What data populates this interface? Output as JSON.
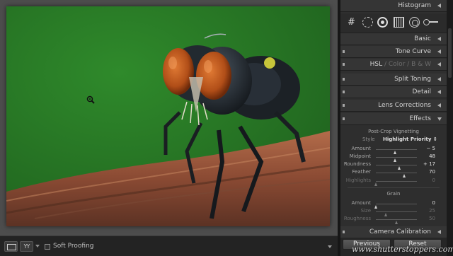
{
  "panels": {
    "histogram": "Histogram",
    "basic": "Basic",
    "tone_curve": "Tone Curve",
    "hsl_tabs": [
      "HSL",
      "Color",
      "B & W"
    ],
    "split_toning": "Split Toning",
    "detail": "Detail",
    "lens_corrections": "Lens Corrections",
    "effects": "Effects",
    "camera_calibration": "Camera Calibration"
  },
  "effects": {
    "vignette_title": "Post-Crop Vignetting",
    "style_label": "Style",
    "style_value": "Highlight Priority",
    "style_arrows": "↕",
    "vignette": [
      {
        "label": "Amount",
        "value": "− 5",
        "fraction": 0.48
      },
      {
        "label": "Midpoint",
        "value": "48",
        "fraction": 0.48
      },
      {
        "label": "Roundness",
        "value": "+ 17",
        "fraction": 0.58
      },
      {
        "label": "Feather",
        "value": "70",
        "fraction": 0.7
      },
      {
        "label": "Highlights",
        "value": "0",
        "fraction": 0.0
      }
    ],
    "grain_title": "Grain",
    "grain": [
      {
        "label": "Amount",
        "value": "0",
        "fraction": 0.0
      },
      {
        "label": "Size",
        "value": "25",
        "fraction": 0.25
      },
      {
        "label": "Roughness",
        "value": "50",
        "fraction": 0.5
      }
    ]
  },
  "toolbar": {
    "compare_glyph": "YY",
    "soft_proofing": "Soft Proofing"
  },
  "buttons": {
    "previous": "Previous",
    "reset": "Reset"
  },
  "grid_glyph": "#",
  "watermark": "www.shutterstoppers.com",
  "colors": {
    "background_green": "#2b7a28",
    "eye_orange": "#c2581c",
    "panel_bg": "#2f2f2f"
  },
  "icons": [
    "grid-overlay-icon",
    "spot-removal-icon",
    "red-eye-icon",
    "graduated-filter-icon",
    "radial-filter-icon",
    "adjustment-brush-icon",
    "zoom-cursor-icon"
  ]
}
